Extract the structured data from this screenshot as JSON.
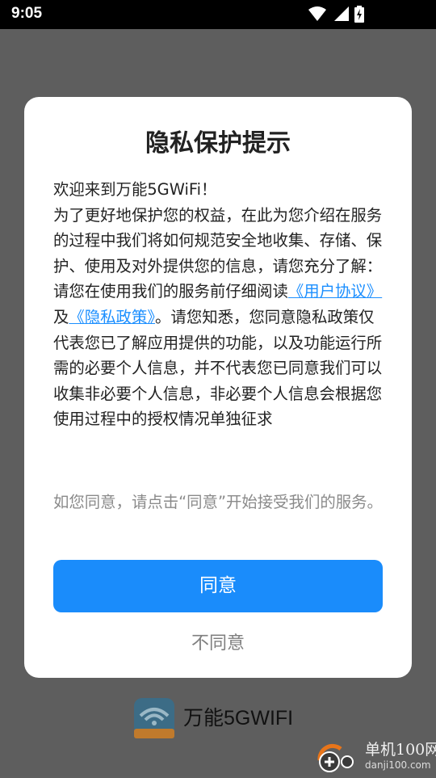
{
  "status_bar": {
    "time": "9:05",
    "icons": [
      "wifi-icon",
      "cellular-signal-icon",
      "battery-charging-icon"
    ]
  },
  "dialog": {
    "title": "隐私保护提示",
    "body": {
      "greeting": "欢迎来到万能5GWiFi！",
      "intro": "为了更好地保护您的权益，在此为您介绍在服务的过程中我们将如何规范安全地收集、存储、保护、使用及对外提供您的信息，请您充分了解：",
      "read_prefix": "请您在使用我们的服务前仔细阅读",
      "user_agreement_link": "《用户协议》",
      "and_text": "及",
      "privacy_policy_link": "《隐私政策》",
      "read_suffix": "。请您知悉，您同意隐私政策仅代表您已了解应用提供的功能，以及功能运行所需的必要个人信息，并不代表您已同意我们可以收集非必要个人信息，非必要个人信息会根据您使用过程中的授权情况单独征求"
    },
    "footnote": "如您同意，请点击“同意”开始接受我们的服务。",
    "agree_label": "同意",
    "disagree_label": "不同意"
  },
  "brand": {
    "name": "万能5GWIFI",
    "logo_icon": "wifi-5g-app-logo"
  },
  "watermark": {
    "site_name": "单机100网",
    "url": "danji100.com"
  },
  "colors": {
    "accent": "#1a8cfb",
    "link": "#1c8fff",
    "scrim": "#5e5e5e",
    "status_bar": "#000000"
  }
}
